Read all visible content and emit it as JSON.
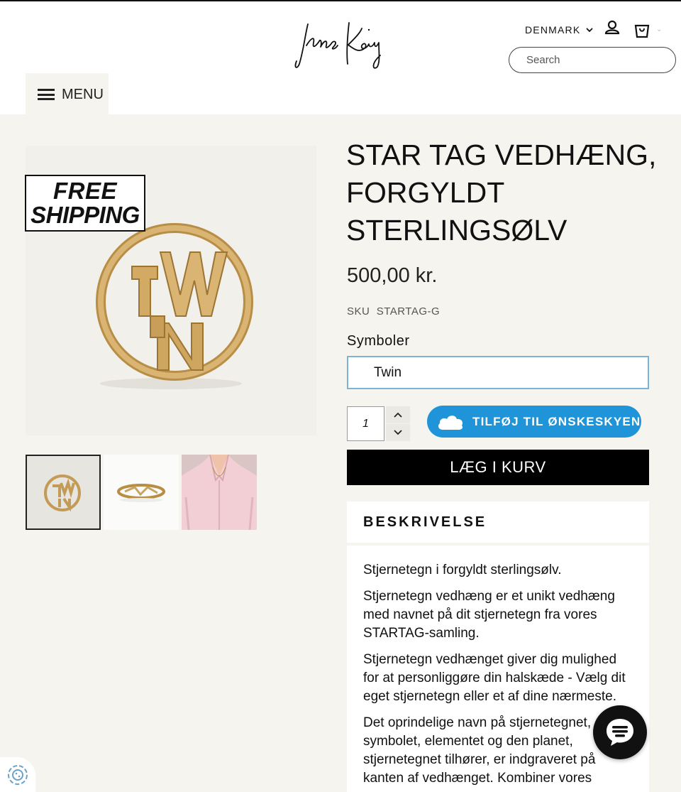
{
  "header": {
    "brand": "Jane Kønig",
    "country": "DENMARK",
    "search_placeholder": "Search",
    "menu_label": "MENU"
  },
  "gallery": {
    "badge_line1": "FREE",
    "badge_line2": "SHIPPING",
    "thumbnails": [
      "pendant-front",
      "pendant-side",
      "model-wearing"
    ]
  },
  "product": {
    "title": "STAR TAG VEDHÆNG, FORGYLDT STERLINGSØLV",
    "price": "500,00 kr.",
    "sku_label": "SKU",
    "sku": "STARTAG-G",
    "option_label": "Symboler",
    "option_value": "Twin",
    "quantity": "1",
    "wishlist_label": "TILFØJ TIL ØNSKESKYEN",
    "add_to_cart_label": "LÆG I KURV"
  },
  "description": {
    "heading": "BESKRIVELSE",
    "paragraphs": [
      "Stjernetegn i forgyldt sterlingsølv.",
      "Stjernetegn vedhæng er et unikt vedhæng med navnet på dit stjernetegn fra vores STARTAG-samling.",
      "Stjernetegn vedhænget giver dig mulighed for at personliggøre din halskæde - Vælg dit eget stjernetegn eller et af dine nærmeste.",
      "Det oprindelige navn på stjernetegnet, symbolet, elementet og den planet, stjernetegnet tilhører, er indgraveret på kanten af vedhænget. Kombiner vores"
    ]
  },
  "colors": {
    "accent_blue": "#1f94d8",
    "background": "#f5f4ef",
    "gold": "#c9a45f"
  }
}
